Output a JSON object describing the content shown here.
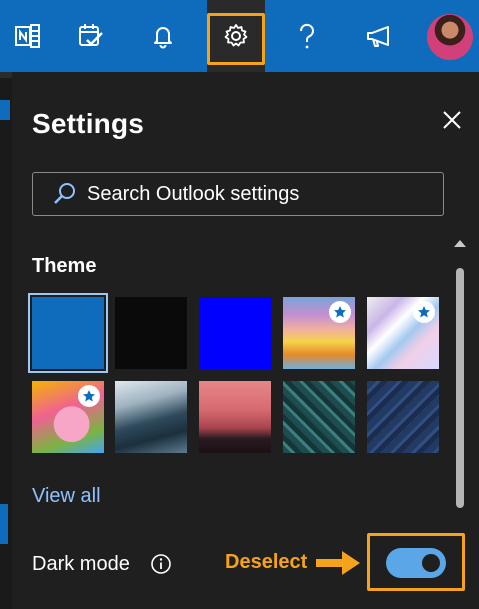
{
  "topbar": {
    "items": [
      {
        "name": "onenote-icon"
      },
      {
        "name": "todo-icon"
      },
      {
        "name": "bell-icon"
      },
      {
        "name": "gear-icon"
      },
      {
        "name": "help-icon"
      },
      {
        "name": "megaphone-icon"
      }
    ],
    "active": "gear-icon",
    "highlight_color": "#f5a31a",
    "accent": "#0f6cbd"
  },
  "settings": {
    "title": "Settings",
    "search_placeholder": "Search Outlook settings",
    "theme_title": "Theme",
    "themes": [
      {
        "name": "blue",
        "selected": true,
        "starred": false
      },
      {
        "name": "black",
        "selected": false,
        "starred": false
      },
      {
        "name": "bright-blue",
        "selected": false,
        "starred": false
      },
      {
        "name": "rainbow",
        "selected": false,
        "starred": true
      },
      {
        "name": "swirl",
        "selected": false,
        "starred": true
      },
      {
        "name": "cartoon",
        "selected": false,
        "starred": true
      },
      {
        "name": "wave",
        "selected": false,
        "starred": false
      },
      {
        "name": "palms",
        "selected": false,
        "starred": false
      },
      {
        "name": "circuit",
        "selected": false,
        "starred": false
      },
      {
        "name": "patent",
        "selected": false,
        "starred": false
      }
    ],
    "view_all": "View all",
    "dark_mode_label": "Dark mode",
    "dark_mode_on": true
  },
  "annotation": {
    "callout": "Deselect"
  }
}
